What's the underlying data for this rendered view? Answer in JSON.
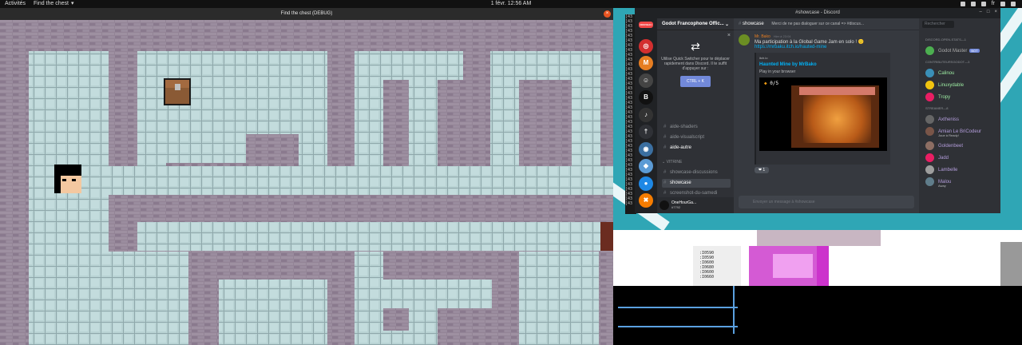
{
  "topbar": {
    "activities": "Activités",
    "app_name": "Find the chest",
    "app_chevron": "▾",
    "clock": "1 févr.  12:56 AM",
    "tray_icons": [
      "network-icon",
      "discord-tray-icon",
      "steam-tray-icon",
      "language-icon",
      "volume-icon",
      "power-icon"
    ],
    "language": "fr"
  },
  "game": {
    "title": "Find the chest (DEBUG)",
    "close": "×",
    "colors": {
      "wall": "#938496",
      "wall_dark": "#7c6a80",
      "floor": "#a8c4c6",
      "floor_line": "#8aa6a9",
      "chest": "#7a4a2a"
    }
  },
  "terminal": {
    "lines": [
      "[43",
      "[43",
      "[43",
      "[43",
      "[43",
      "[43",
      "[43",
      "[43",
      "[43",
      "[43",
      "[43",
      "[43",
      "[43",
      "[43",
      "[43",
      "[43",
      "[43",
      "[43",
      "[43",
      "[43",
      "[43",
      "[43",
      "[43",
      "[43",
      "[43",
      "[43",
      "[43",
      "[43",
      "[43",
      "[43",
      "[43",
      "[43",
      "[43",
      "[43",
      "[43",
      "[43",
      "[43",
      "[43",
      "[43",
      "[43"
    ],
    "bottom_lines": [
      ":I0590",
      ":I0590",
      ":I0600",
      ":I0680",
      ":I0600",
      ":I0660"
    ]
  },
  "discord": {
    "window_title": "#showcase - Discord",
    "window_controls": [
      "–",
      "□",
      "×"
    ],
    "guilds": [
      {
        "label": "NOUVEAU",
        "color": "#f04747"
      },
      {
        "label": "◎",
        "color": "#d32f2f"
      },
      {
        "label": "M",
        "color": "#e67e22"
      },
      {
        "label": "☺",
        "color": "#444"
      },
      {
        "label": "B",
        "color": "#111"
      },
      {
        "label": "♪",
        "color": "#333"
      },
      {
        "label": "†",
        "color": "#2f3136"
      },
      {
        "label": "◉",
        "color": "#3b6fa0"
      },
      {
        "label": "◆",
        "color": "#5b9bd5"
      },
      {
        "label": "●",
        "color": "#1e88e5"
      },
      {
        "label": "✖",
        "color": "#f57c00"
      }
    ],
    "server_name": "Godot Francophone Offic...",
    "server_chevron": "⌄",
    "quick_switcher": {
      "close": "×",
      "text": "Utilise Quick Switcher pour te déplacer rapidement dans Discord. Il te suffit d'appuyer sur :",
      "button": "CTRL + K"
    },
    "channels": [
      "aide-shaders",
      "aide-visualscript",
      "aide-autre"
    ],
    "category": "⌄ VITRINE",
    "vitrine_channels": [
      "showcase-discussions",
      "showcase",
      "screenshot-du-samedi",
      "showcase-vfx"
    ],
    "selected_channel": "showcase",
    "user": {
      "name": "OneHourGa...",
      "tag": "#7792"
    },
    "chat": {
      "channel": "showcase",
      "topic": "Merci de ne pas dialoguer sur ce canal => #discus...",
      "author": "Mr. Bako",
      "timestamp": "Hier à 23:04",
      "text": "Ma participation à la Global Game Jam en solo ! 🙂",
      "link": "https://mrbaku.itch.io/hauted-mine",
      "embed_provider": "itch.io",
      "embed_title": "Haunted Mine by MrBako",
      "embed_desc": "Play in your browser",
      "embed_hud": "0/5",
      "reaction": "❤ 1",
      "composer_placeholder": "Envoyer un message à #showcase"
    },
    "members": {
      "search_placeholder": "Rechercher",
      "groups": [
        {
          "label": "DISCORD-OPEN-STATS—1",
          "names": [
            {
              "name": "Godot Master",
              "tag": "BOT",
              "color": "#aaa",
              "avatar": "#4caf50"
            }
          ]
        },
        {
          "label": "CONTRIBUTEURSGODOT—3",
          "names": [
            {
              "name": "Calinou",
              "color": "#9be8a0",
              "avatar": "#3a8fb7"
            },
            {
              "name": "Linuxydable",
              "color": "#9be8a0",
              "avatar": "#f1c40f"
            },
            {
              "name": "Tropy",
              "color": "#9be8a0",
              "avatar": "#e91e63"
            }
          ]
        },
        {
          "label": "STREAMER—8",
          "names": [
            {
              "name": "Axtheniss",
              "color": "#b39ddb",
              "avatar": "#666"
            },
            {
              "name": "Amian Le BriCodeur",
              "sub": "Joue à Ready!",
              "color": "#b39ddb",
              "avatar": "#795548"
            },
            {
              "name": "Goldenbeet",
              "color": "#b39ddb",
              "avatar": "#8d6e63"
            },
            {
              "name": "Jadd",
              "color": "#b39ddb",
              "avatar": "#e91e63"
            },
            {
              "name": "Lambelle",
              "color": "#b39ddb",
              "avatar": "#9e9e9e"
            },
            {
              "name": "Malou",
              "sub": "Away",
              "color": "#b39ddb",
              "avatar": "#607d8b"
            }
          ]
        }
      ]
    }
  }
}
